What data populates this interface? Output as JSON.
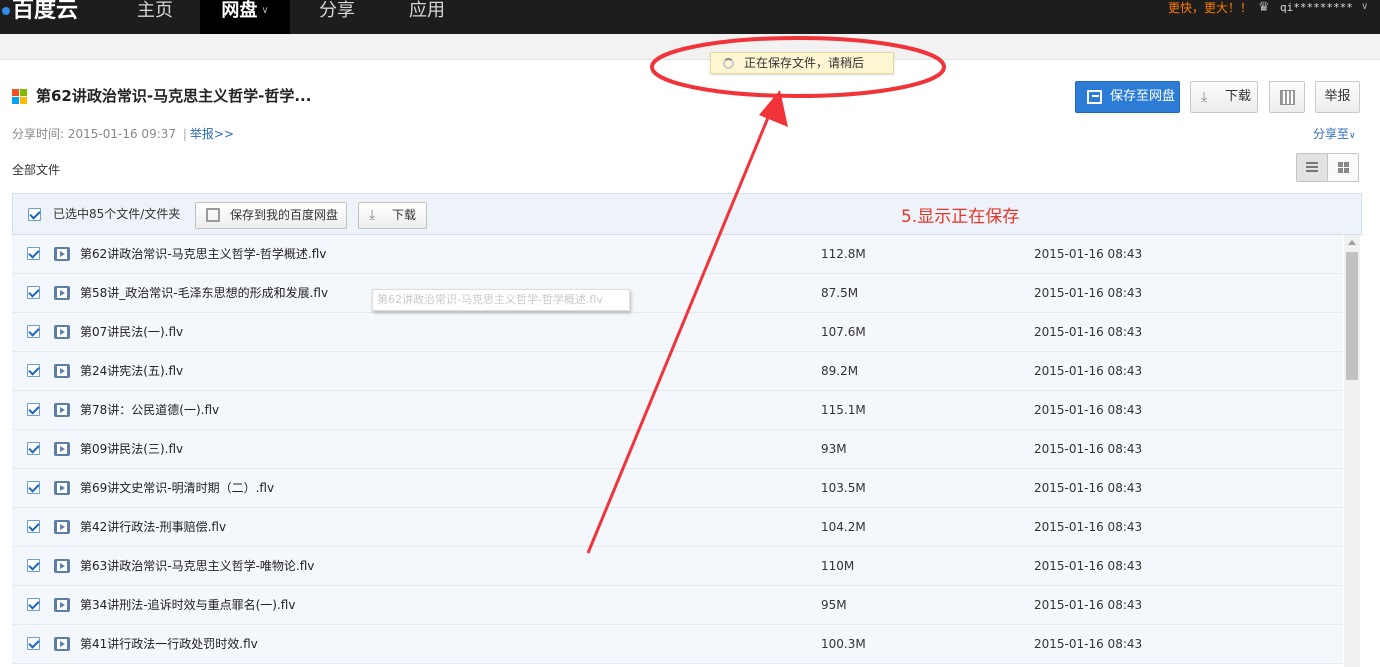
{
  "nav": {
    "logo": "百度云",
    "items": [
      "主页",
      "网盘",
      "分享",
      "应用"
    ],
    "promo": "更快，更大！！",
    "user": "qi*********"
  },
  "toast": "正在保存文件，请稍后",
  "header": {
    "title": "第62讲政治常识-马克思主义哲学-哲学...",
    "share_time_label": "分享时间:",
    "share_time": "2015-01-16 09:37",
    "separator": "|",
    "report_link": "举报>>",
    "save_button": "保存至网盘",
    "download_button": "下载",
    "report_button": "举报",
    "share_to": "分享至"
  },
  "all_files": "全部文件",
  "toolbar": {
    "selected": "已选中85个文件/文件夹",
    "save_button": "保存到我的百度网盘",
    "download_button": "下载"
  },
  "annotation": "5.显示正在保存",
  "ghost_tooltip": "第62讲政治常识-马克思主义哲学-哲学概述.flv",
  "files": [
    {
      "name": "第62讲政治常识-马克思主义哲学-哲学概述.flv",
      "size": "112.8M",
      "date": "2015-01-16 08:43"
    },
    {
      "name": "第58讲_政治常识-毛泽东思想的形成和发展.flv",
      "size": "87.5M",
      "date": "2015-01-16 08:43"
    },
    {
      "name": "第07讲民法(一).flv",
      "size": "107.6M",
      "date": "2015-01-16 08:43"
    },
    {
      "name": "第24讲宪法(五).flv",
      "size": "89.2M",
      "date": "2015-01-16 08:43"
    },
    {
      "name": "第78讲：公民道德(一).flv",
      "size": "115.1M",
      "date": "2015-01-16 08:43"
    },
    {
      "name": "第09讲民法(三).flv",
      "size": "93M",
      "date": "2015-01-16 08:43"
    },
    {
      "name": "第69讲文史常识-明清时期（二）.flv",
      "size": "103.5M",
      "date": "2015-01-16 08:43"
    },
    {
      "name": "第42讲行政法-刑事赔偿.flv",
      "size": "104.2M",
      "date": "2015-01-16 08:43"
    },
    {
      "name": "第63讲政治常识-马克思主义哲学-唯物论.flv",
      "size": "110M",
      "date": "2015-01-16 08:43"
    },
    {
      "name": "第34讲刑法-追诉时效与重点罪名(一).flv",
      "size": "95M",
      "date": "2015-01-16 08:43"
    },
    {
      "name": "第41讲行政法一行政处罚时效.flv",
      "size": "100.3M",
      "date": "2015-01-16 08:43"
    }
  ],
  "colors": {
    "topbar": "#1d1d1d",
    "accent": "#2c7cd6",
    "promo": "#ff7a00",
    "annotation": "#e8342b"
  }
}
